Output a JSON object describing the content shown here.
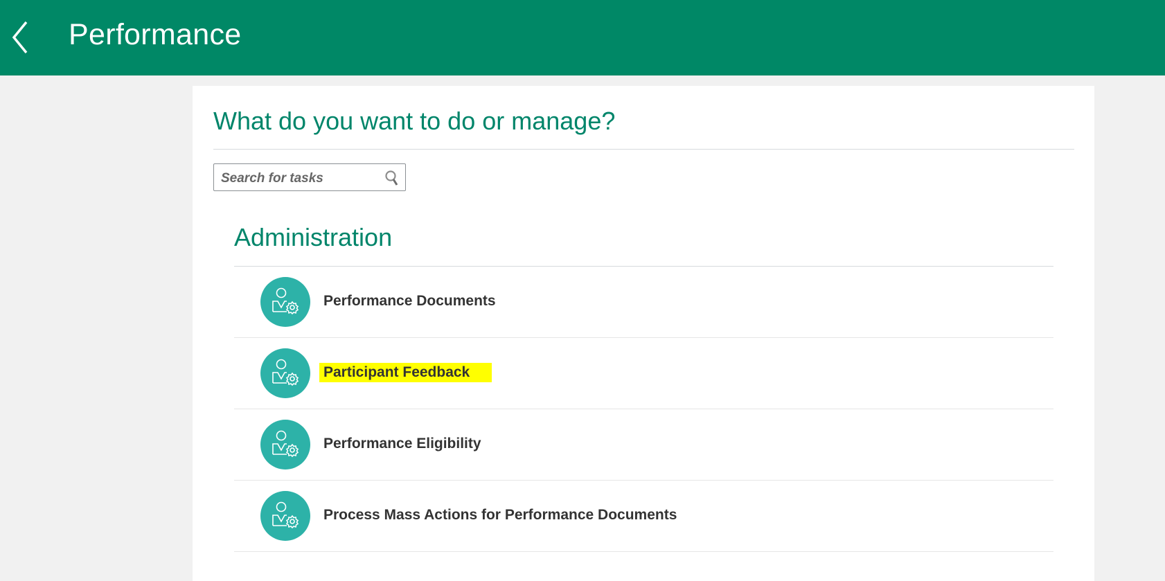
{
  "header": {
    "title": "Performance",
    "back_icon": "chevron-left-icon"
  },
  "main": {
    "question": "What do you want to do or manage?",
    "search": {
      "placeholder": "Search for tasks",
      "value": "",
      "icon": "search-icon"
    },
    "section": {
      "title": "Administration",
      "items": [
        {
          "label": "Performance Documents",
          "icon": "user-gear-icon",
          "highlighted": false
        },
        {
          "label": "Participant Feedback",
          "icon": "user-gear-icon",
          "highlighted": true
        },
        {
          "label": "Performance Eligibility",
          "icon": "user-gear-icon",
          "highlighted": false
        },
        {
          "label": "Process Mass Actions for Performance Documents",
          "icon": "user-gear-icon",
          "highlighted": false
        }
      ]
    }
  },
  "colors": {
    "header": "#008866",
    "accent": "#00856a",
    "icon_bg": "#2db2a8",
    "highlight": "#ffff00"
  }
}
